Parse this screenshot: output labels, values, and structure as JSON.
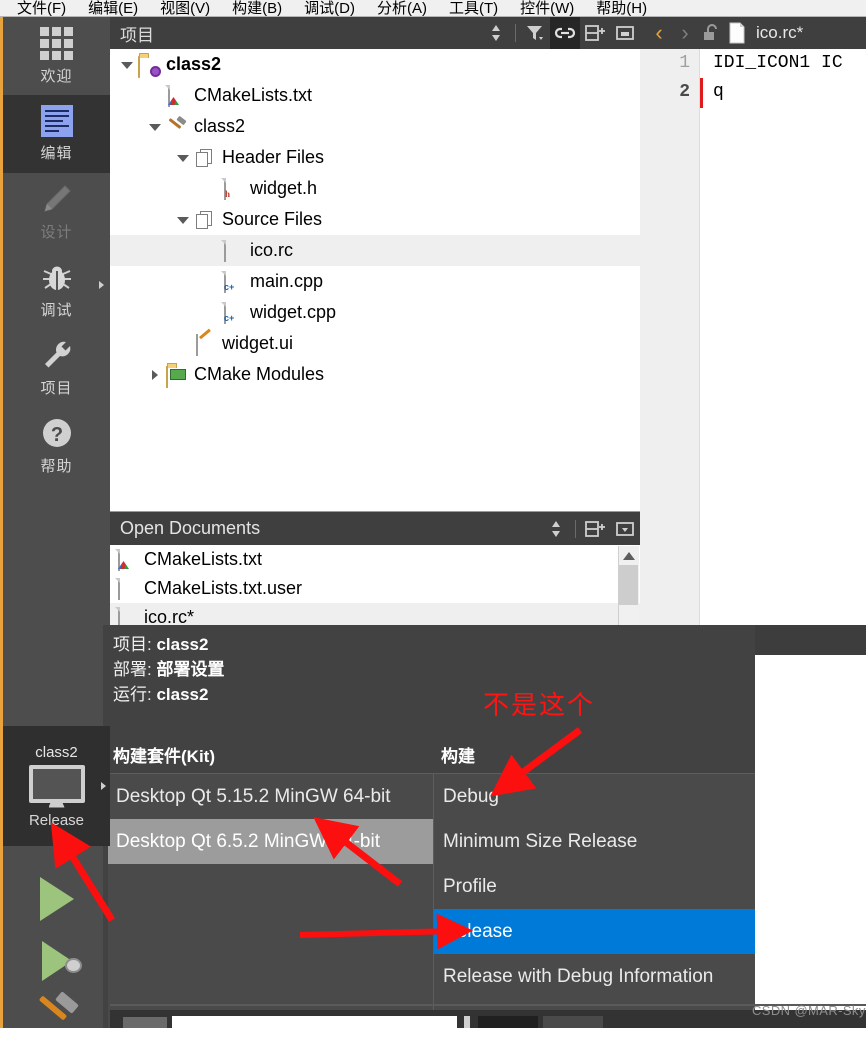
{
  "menubar": {
    "items": [
      {
        "label": "文件(F)",
        "key": "F"
      },
      {
        "label": "编辑(E)",
        "key": "E"
      },
      {
        "label": "视图(V)",
        "key": "V"
      },
      {
        "label": "构建(B)",
        "key": "B"
      },
      {
        "label": "调试(D)",
        "key": "D"
      },
      {
        "label": "分析(A)",
        "key": "A"
      },
      {
        "label": "工具(T)",
        "key": "T"
      },
      {
        "label": "控件(W)",
        "key": "W"
      },
      {
        "label": "帮助(H)",
        "key": "H"
      }
    ]
  },
  "modebar": {
    "items": [
      {
        "label": "欢迎",
        "icon": "grid-icon",
        "state": "normal"
      },
      {
        "label": "编辑",
        "icon": "document-lines-icon",
        "state": "selected"
      },
      {
        "label": "设计",
        "icon": "pencil-icon",
        "state": "disabled"
      },
      {
        "label": "调试",
        "icon": "bug-icon",
        "state": "normal",
        "has_arrow": true
      },
      {
        "label": "项目",
        "icon": "wrench-icon",
        "state": "normal"
      },
      {
        "label": "帮助",
        "icon": "question-circle-icon",
        "state": "normal"
      }
    ]
  },
  "project_dock": {
    "title": "项目",
    "toolbar": [
      {
        "name": "sync-updown-icon",
        "active": false
      },
      {
        "name": "filter-icon",
        "active": false
      },
      {
        "name": "link-icon",
        "active": true
      },
      {
        "name": "split-add-icon",
        "active": false
      },
      {
        "name": "close-panel-icon",
        "active": false
      }
    ],
    "tree": [
      {
        "label": "class2",
        "indent": 0,
        "twisty": "down",
        "icon": "folder-project-icon",
        "bold": true,
        "selected": false
      },
      {
        "label": "CMakeLists.txt",
        "indent": 1,
        "twisty": "none",
        "icon": "cmake-file-icon",
        "bold": false,
        "selected": false
      },
      {
        "label": "class2",
        "indent": 1,
        "twisty": "down",
        "icon": "hammer-target-icon",
        "bold": false,
        "selected": false
      },
      {
        "label": "Header Files",
        "indent": 2,
        "twisty": "down",
        "icon": "files-group-icon",
        "bold": false,
        "selected": false
      },
      {
        "label": "widget.h",
        "indent": 3,
        "twisty": "none",
        "icon": "header-file-icon",
        "bold": false,
        "selected": false
      },
      {
        "label": "Source Files",
        "indent": 2,
        "twisty": "down",
        "icon": "files-group-icon",
        "bold": false,
        "selected": false
      },
      {
        "label": "ico.rc",
        "indent": 3,
        "twisty": "none",
        "icon": "plain-file-icon",
        "bold": false,
        "selected": true
      },
      {
        "label": "main.cpp",
        "indent": 3,
        "twisty": "none",
        "icon": "cpp-file-icon",
        "bold": false,
        "selected": false
      },
      {
        "label": "widget.cpp",
        "indent": 3,
        "twisty": "none",
        "icon": "cpp-file-icon",
        "bold": false,
        "selected": false
      },
      {
        "label": "widget.ui",
        "indent": 2,
        "twisty": "none",
        "icon": "ui-file-icon",
        "bold": false,
        "selected": false
      },
      {
        "label": "CMake Modules",
        "indent": 1,
        "twisty": "right",
        "icon": "modules-folder-icon",
        "bold": false,
        "selected": false
      }
    ]
  },
  "open_documents": {
    "title": "Open Documents",
    "toolbar": [
      {
        "name": "sync-updown-icon",
        "active": false
      },
      {
        "name": "split-add-icon",
        "active": false
      },
      {
        "name": "close-panel-icon",
        "active": false
      }
    ],
    "items": [
      {
        "label": "CMakeLists.txt",
        "icon": "cmake-file-icon",
        "selected": false
      },
      {
        "label": "CMakeLists.txt.user",
        "icon": "plain-file-icon",
        "selected": false
      },
      {
        "label": "ico.rc*",
        "icon": "plain-file-icon",
        "selected": true
      }
    ],
    "scrollbar": {
      "name": "vertical-scrollbar"
    }
  },
  "editor": {
    "toolbar": {
      "back": "‹",
      "forward": "›",
      "lock_icon": "unlocked-icon",
      "file_icon": "plain-file-icon",
      "filename": "ico.rc*"
    },
    "line_numbers": [
      "1",
      "2"
    ],
    "lines": [
      "IDI_ICON1 IC",
      "q"
    ],
    "cursor_line": 2
  },
  "kit_popup": {
    "info": [
      {
        "label": "项目:",
        "value": "class2"
      },
      {
        "label": "部署:",
        "value": "部署设置"
      },
      {
        "label": "运行:",
        "value": "class2"
      }
    ],
    "kit_column": {
      "header": "构建套件(Kit)",
      "items": [
        {
          "label": "Desktop Qt 5.15.2 MinGW 64-bit",
          "selected": false
        },
        {
          "label": "Desktop Qt 6.5.2 MinGW 64-bit",
          "selected": true
        }
      ]
    },
    "build_column": {
      "header": "构建",
      "items": [
        {
          "label": "Debug",
          "selected": false
        },
        {
          "label": "Minimum Size Release",
          "selected": false
        },
        {
          "label": "Profile",
          "selected": false
        },
        {
          "label": "Release",
          "selected": true
        },
        {
          "label": "Release with Debug Information",
          "selected": false
        }
      ]
    }
  },
  "run_controls": {
    "kit_selector": {
      "project": "class2",
      "configuration": "Release",
      "icon": "monitor-icon"
    },
    "buttons": [
      {
        "name": "run-button",
        "icon": "green-play-icon"
      },
      {
        "name": "debug-button",
        "icon": "green-play-bug-icon"
      },
      {
        "name": "build-button",
        "icon": "hammer-icon"
      }
    ]
  },
  "annotations": {
    "note": "不是这个",
    "color": "#ff1414",
    "arrows": 3
  },
  "watermark": "CSDN @MAR-Sky",
  "colors": {
    "accent_orange": "#e8a33d",
    "selection_blue": "#007ad9",
    "panel_dark": "#424242",
    "header_dark": "#3f3f3f",
    "modebar": "#4d4d4d",
    "annotation_red": "#ff1414"
  }
}
